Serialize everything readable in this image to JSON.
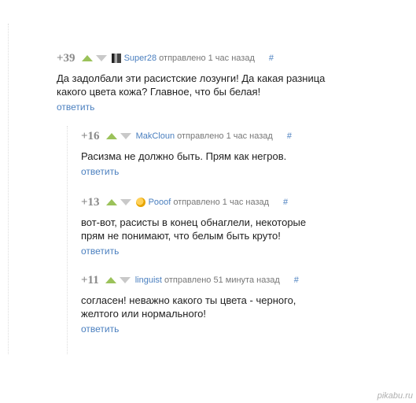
{
  "comments": [
    {
      "score": "+39",
      "user": "Super28",
      "meta": "отправлено 1 час назад",
      "hash": "#",
      "text_lines": [
        "Да задолбали эти расистские лозунги! Да какая разница",
        "какого цвета кожа? Главное, что бы белая!"
      ],
      "reply": "ответить"
    },
    {
      "score": "+16",
      "user": "MakCloun",
      "meta": "отправлено 1 час назад",
      "hash": "#",
      "text_lines": [
        "Расизма не должно быть. Прям как негров."
      ],
      "reply": "ответить"
    },
    {
      "score": "+13",
      "user": "Pooof",
      "meta": "отправлено 1 час назад",
      "hash": "#",
      "text_lines": [
        "вот-вот, расисты в конец обнаглели, некоторые",
        "прям не понимают, что белым быть круто!"
      ],
      "reply": "ответить"
    },
    {
      "score": "+11",
      "user": "linguist",
      "meta": "отправлено 51 минута назад",
      "hash": "#",
      "text_lines": [
        "согласен! неважно какого ты цвета - черного,",
        "желтого или нормального!"
      ],
      "reply": "ответить"
    }
  ],
  "watermark": "pikabu.ru",
  "colors": {
    "upvote": "#9bc25a",
    "link": "#4a7fbf",
    "text": "#222222"
  }
}
